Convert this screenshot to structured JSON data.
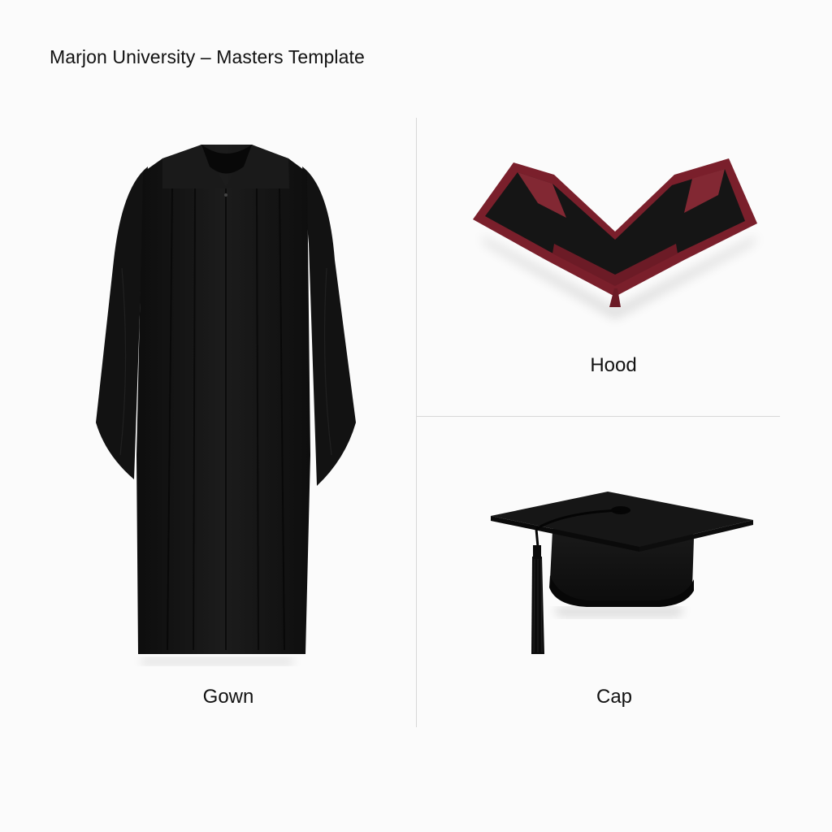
{
  "header": {
    "title": "Marjon University – Masters Template"
  },
  "items": {
    "gown": {
      "label": "Gown",
      "icon": "academic-gown-icon"
    },
    "hood": {
      "label": "Hood",
      "icon": "academic-hood-icon"
    },
    "cap": {
      "label": "Cap",
      "icon": "mortarboard-cap-icon"
    }
  },
  "colors": {
    "background": "#fbfbfb",
    "garment_black": "#151515",
    "hood_lining": "#7a1f2b",
    "divider": "#d8d8d8",
    "text": "#111111"
  }
}
